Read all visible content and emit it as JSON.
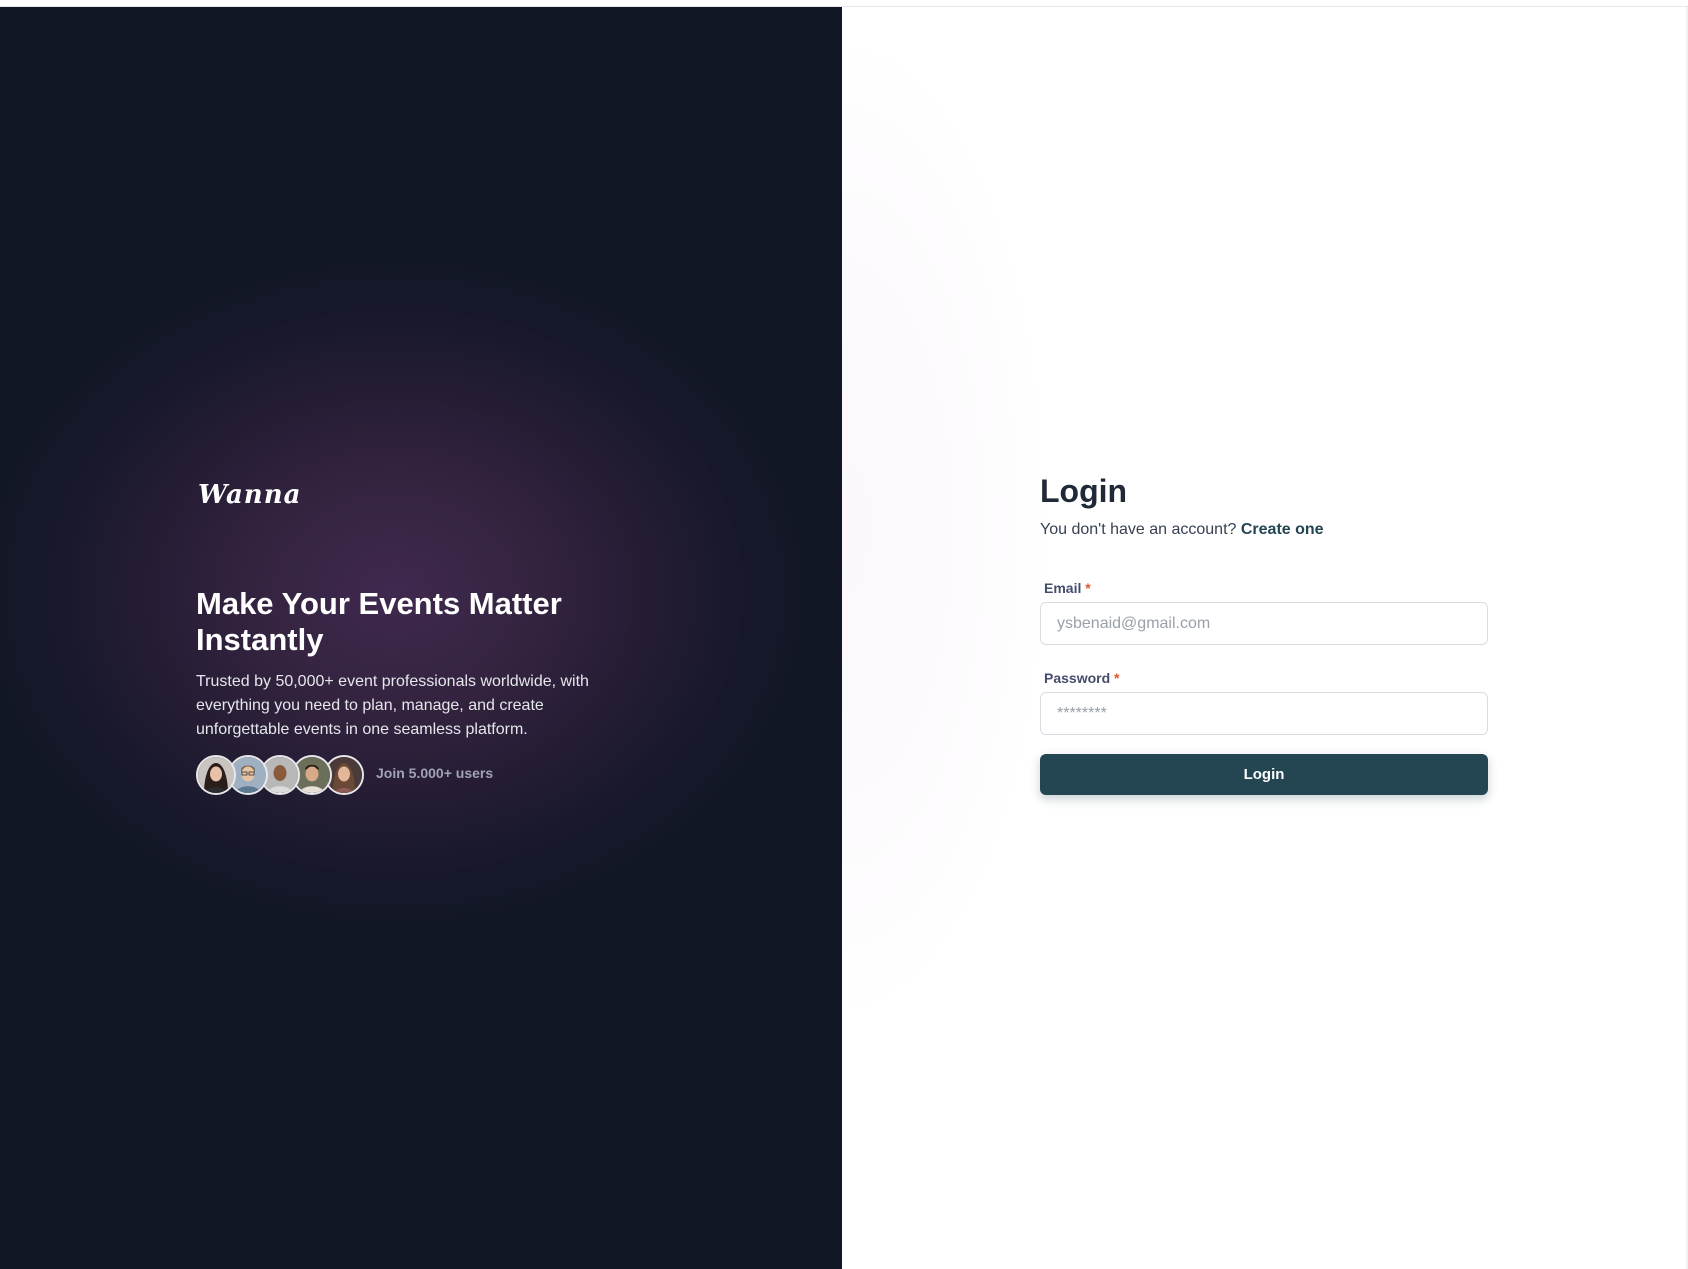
{
  "brand": {
    "logo_text": "Wanna"
  },
  "hero": {
    "title": "Make Your Events Matter Instantly",
    "description": "Trusted by 50,000+ event professionals worldwide, with everything you need to plan, manage, and create unforgettable events in one seamless platform.",
    "join_text": "Join 5.000+ users",
    "avatars": [
      "avatar-1",
      "avatar-2",
      "avatar-3",
      "avatar-4",
      "avatar-5"
    ]
  },
  "login": {
    "title": "Login",
    "subtitle_prefix": "You don't have an account?",
    "create_link": "Create one",
    "email_label": "Email",
    "email_placeholder": "ysbenaid@gmail.com",
    "password_label": "Password",
    "password_placeholder": "********",
    "required_marker": "*",
    "button_label": "Login"
  },
  "colors": {
    "left_bg_dark": "#121726",
    "left_bg_glow": "#40294f",
    "button_bg": "#244552",
    "required": "#e4572e"
  }
}
